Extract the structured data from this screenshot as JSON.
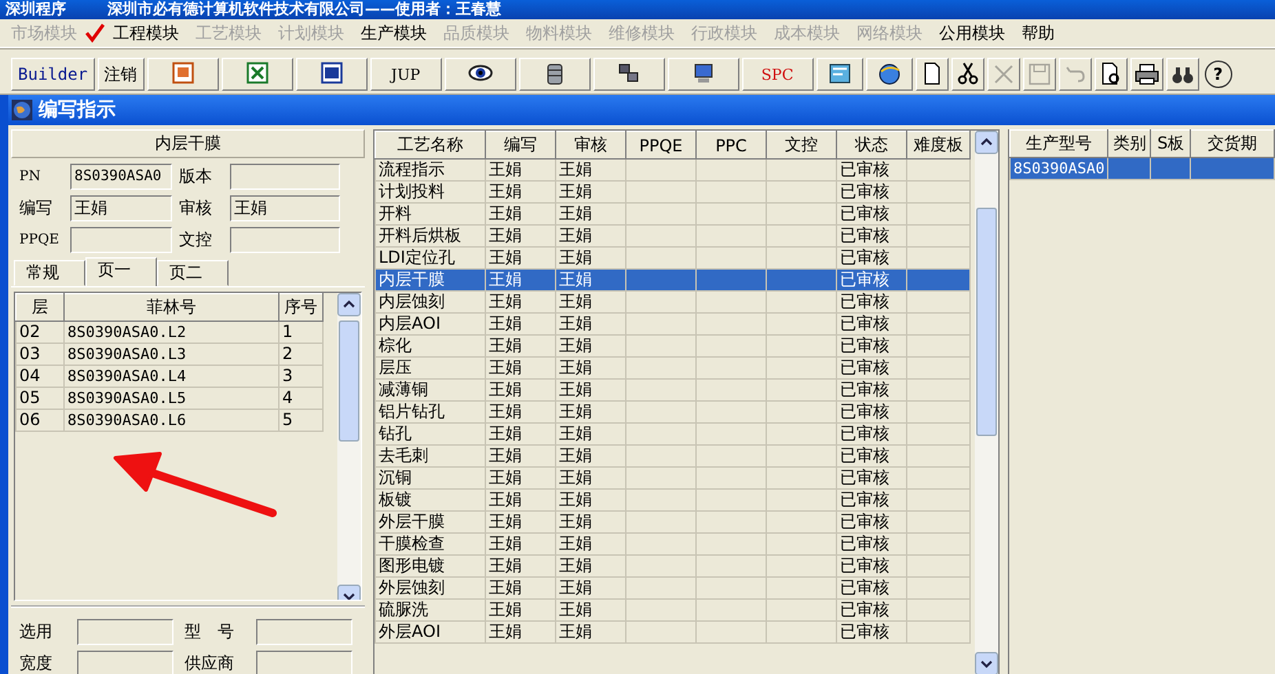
{
  "app_title": "深圳程序",
  "company_title": "深圳市必有德计算机软件技术有限公司——使用者：王春慧",
  "menu": [
    {
      "label": "市场模块",
      "disabled": true,
      "checked": false
    },
    {
      "label": "工程模块",
      "disabled": false,
      "checked": true
    },
    {
      "label": "工艺模块",
      "disabled": true,
      "checked": false
    },
    {
      "label": "计划模块",
      "disabled": true,
      "checked": false
    },
    {
      "label": "生产模块",
      "disabled": false,
      "checked": false
    },
    {
      "label": "品质模块",
      "disabled": true,
      "checked": false
    },
    {
      "label": "物料模块",
      "disabled": true,
      "checked": false
    },
    {
      "label": "维修模块",
      "disabled": true,
      "checked": false
    },
    {
      "label": "行政模块",
      "disabled": true,
      "checked": false
    },
    {
      "label": "成本模块",
      "disabled": true,
      "checked": false
    },
    {
      "label": "网络模块",
      "disabled": true,
      "checked": false
    },
    {
      "label": "公用模块",
      "disabled": false,
      "checked": false
    },
    {
      "label": "帮助",
      "disabled": false,
      "checked": false
    }
  ],
  "toolbar": [
    {
      "kind": "label",
      "label": "Builder"
    },
    {
      "kind": "label",
      "label": "注销"
    },
    {
      "kind": "big",
      "disabled": false
    },
    {
      "kind": "big",
      "disabled": false
    },
    {
      "kind": "big",
      "disabled": false
    },
    {
      "kind": "big",
      "label": "JUP",
      "disabled": false
    },
    {
      "kind": "big",
      "disabled": false
    },
    {
      "kind": "big",
      "disabled": false
    },
    {
      "kind": "big",
      "disabled": false
    },
    {
      "kind": "big",
      "disabled": false
    },
    {
      "kind": "big",
      "label": "SPC",
      "disabled": false
    },
    {
      "kind": "medium",
      "disabled": false
    },
    {
      "kind": "medium",
      "disabled": false
    },
    {
      "kind": "small",
      "disabled": false
    },
    {
      "kind": "small",
      "disabled": false
    },
    {
      "kind": "small",
      "disabled": true
    },
    {
      "kind": "small",
      "disabled": true
    },
    {
      "kind": "small",
      "disabled": true
    },
    {
      "kind": "small",
      "disabled": false
    },
    {
      "kind": "small",
      "disabled": false
    },
    {
      "kind": "small",
      "disabled": false
    },
    {
      "kind": "small",
      "label": "?",
      "disabled": false
    }
  ],
  "window": {
    "title": "编写指示"
  },
  "process_form": {
    "heading": "内层干膜",
    "fields": [
      {
        "label": "PN",
        "value": "8S0390ASA0"
      },
      {
        "label": "版本"
      },
      {
        "label": "编写",
        "value": "王娟"
      },
      {
        "label": "审核",
        "value": "王娟"
      },
      {
        "label": "PPQE"
      },
      {
        "label": "文控"
      }
    ],
    "tabs": [
      {
        "label": "常规",
        "selected": false
      },
      {
        "label": "页一",
        "selected": true
      },
      {
        "label": "页二",
        "selected": false
      }
    ],
    "layers": {
      "columns": [
        "层",
        "菲林号",
        "序号"
      ],
      "rows": [
        {
          "layer": "02",
          "film": "8S0390ASA0.L2",
          "seq": "1",
          "selected": false
        },
        {
          "layer": "03",
          "film": "8S0390ASA0.L3",
          "seq": "2",
          "selected": false
        },
        {
          "layer": "04",
          "film": "8S0390ASA0.L4",
          "seq": "3",
          "selected": false
        },
        {
          "layer": "05",
          "film": "8S0390ASA0.L5",
          "seq": "4",
          "selected": false
        },
        {
          "layer": "06",
          "film": "8S0390ASA0.L6",
          "seq": "5",
          "selected": false
        }
      ]
    },
    "bottom_fields": [
      {
        "label": "选用"
      },
      {
        "label": "型　号"
      },
      {
        "label": "宽度"
      },
      {
        "label": "供应商"
      }
    ]
  },
  "steps": {
    "columns": [
      "工艺名称",
      "编写",
      "审核",
      "PPQE",
      "PPC",
      "文控",
      "状态",
      "难度板"
    ],
    "rows": [
      {
        "name": "流程指示",
        "author": "王娟",
        "reviewer": "王娟",
        "status": "已审核",
        "selected": false
      },
      {
        "name": "计划投料",
        "author": "王娟",
        "reviewer": "王娟",
        "status": "已审核",
        "selected": false
      },
      {
        "name": "开料",
        "author": "王娟",
        "reviewer": "王娟",
        "status": "已审核",
        "selected": false
      },
      {
        "name": "开料后烘板",
        "author": "王娟",
        "reviewer": "王娟",
        "status": "已审核",
        "selected": false
      },
      {
        "name": "LDI定位孔",
        "author": "王娟",
        "reviewer": "王娟",
        "status": "已审核",
        "selected": false
      },
      {
        "name": "内层干膜",
        "author": "王娟",
        "reviewer": "王娟",
        "status": "已审核",
        "selected": true
      },
      {
        "name": "内层蚀刻",
        "author": "王娟",
        "reviewer": "王娟",
        "status": "已审核",
        "selected": false
      },
      {
        "name": "内层AOI",
        "author": "王娟",
        "reviewer": "王娟",
        "status": "已审核",
        "selected": false
      },
      {
        "name": "棕化",
        "author": "王娟",
        "reviewer": "王娟",
        "status": "已审核",
        "selected": false
      },
      {
        "name": "层压",
        "author": "王娟",
        "reviewer": "王娟",
        "status": "已审核",
        "selected": false
      },
      {
        "name": "减薄铜",
        "author": "王娟",
        "reviewer": "王娟",
        "status": "已审核",
        "selected": false
      },
      {
        "name": "铝片钻孔",
        "author": "王娟",
        "reviewer": "王娟",
        "status": "已审核",
        "selected": false
      },
      {
        "name": "钻孔",
        "author": "王娟",
        "reviewer": "王娟",
        "status": "已审核",
        "selected": false
      },
      {
        "name": "去毛刺",
        "author": "王娟",
        "reviewer": "王娟",
        "status": "已审核",
        "selected": false
      },
      {
        "name": "沉铜",
        "author": "王娟",
        "reviewer": "王娟",
        "status": "已审核",
        "selected": false
      },
      {
        "name": "板镀",
        "author": "王娟",
        "reviewer": "王娟",
        "status": "已审核",
        "selected": false
      },
      {
        "name": "外层干膜",
        "author": "王娟",
        "reviewer": "王娟",
        "status": "已审核",
        "selected": false
      },
      {
        "name": "干膜检查",
        "author": "王娟",
        "reviewer": "王娟",
        "status": "已审核",
        "selected": false
      },
      {
        "name": "图形电镀",
        "author": "王娟",
        "reviewer": "王娟",
        "status": "已审核",
        "selected": false
      },
      {
        "name": "外层蚀刻",
        "author": "王娟",
        "reviewer": "王娟",
        "status": "已审核",
        "selected": false
      },
      {
        "name": "硫脲洗",
        "author": "王娟",
        "reviewer": "王娟",
        "status": "已审核",
        "selected": false
      },
      {
        "name": "外层AOI",
        "author": "王娟",
        "reviewer": "王娟",
        "status": "已审核",
        "selected": false
      }
    ]
  },
  "products": {
    "columns": [
      "生产型号",
      "类别",
      "S板",
      "交货期"
    ],
    "rows": [
      {
        "model": "8S0390ASA0",
        "selected": true
      }
    ]
  }
}
